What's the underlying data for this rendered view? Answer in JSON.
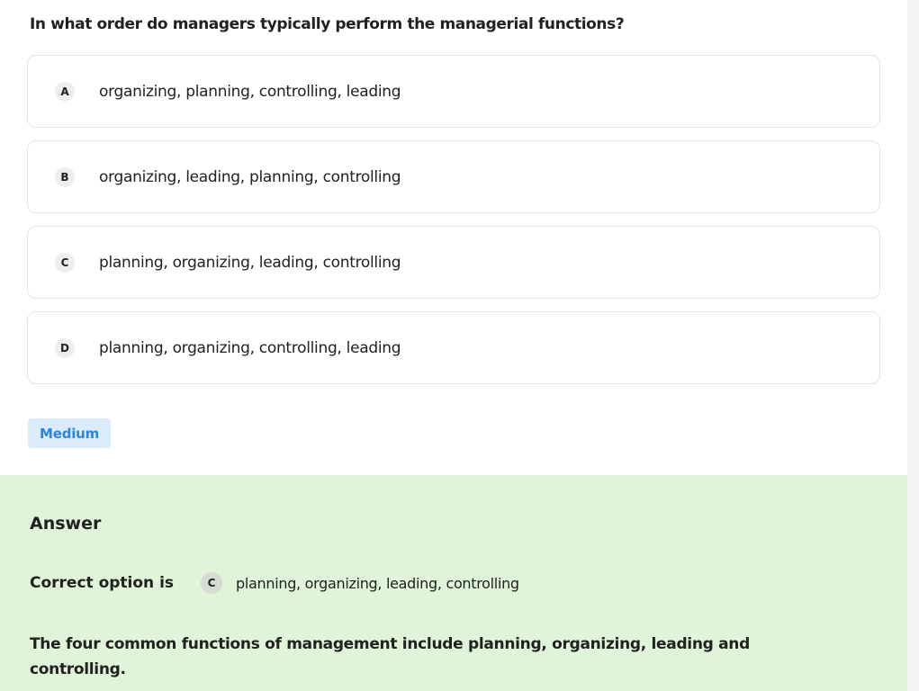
{
  "question": {
    "text": "In what order do managers typically perform the managerial functions?"
  },
  "options": [
    {
      "letter": "A",
      "text": "organizing, planning, controlling, leading"
    },
    {
      "letter": "B",
      "text": "organizing, leading, planning, controlling"
    },
    {
      "letter": "C",
      "text": "planning, organizing, leading, controlling"
    },
    {
      "letter": "D",
      "text": "planning, organizing, controlling, leading"
    }
  ],
  "difficulty": {
    "label": "Medium",
    "color": "#2a86e6",
    "background": "#dcebfc"
  },
  "answer": {
    "heading": "Answer",
    "correct_label": "Correct option is",
    "correct_letter": "C",
    "correct_text": "planning, organizing, leading, controlling",
    "explanation": "The four common functions of management include planning, organizing, leading and controlling.",
    "panel_color": "#dff4d8"
  }
}
